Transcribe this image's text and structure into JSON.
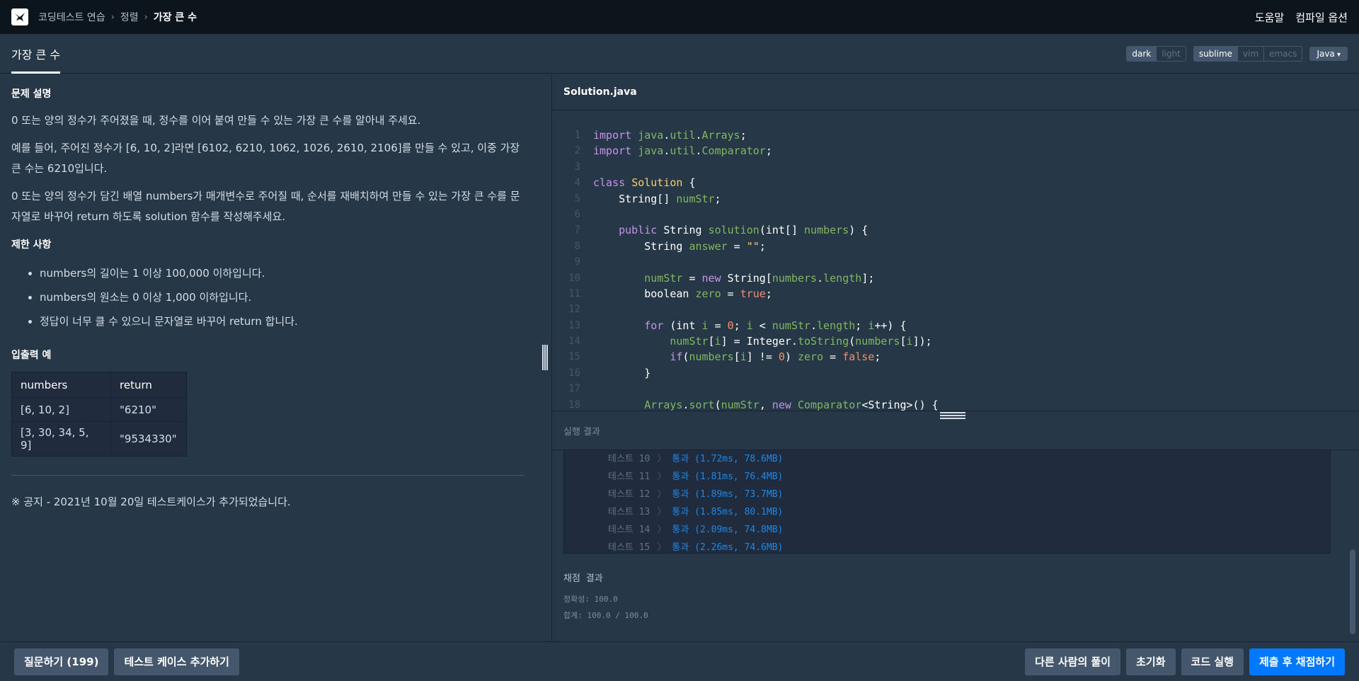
{
  "breadcrumb": {
    "items": [
      "코딩테스트 연습",
      "정렬"
    ],
    "current": "가장 큰 수"
  },
  "topbar": {
    "help": "도움말",
    "compile_options": "컴파일 옵션"
  },
  "title_tab": "가장 큰 수",
  "theme_toggle": {
    "dark": "dark",
    "light": "light"
  },
  "keymap_toggle": {
    "sublime": "sublime",
    "vim": "vim",
    "emacs": "emacs"
  },
  "language": "Java",
  "problem": {
    "desc_title": "문제 설명",
    "para1": "0 또는 양의 정수가 주어졌을 때, 정수를 이어 붙여 만들 수 있는 가장 큰 수를 알아내 주세요.",
    "para2": "예를 들어, 주어진 정수가 [6, 10, 2]라면 [6102, 6210, 1062, 1026, 2610, 2106]를 만들 수 있고, 이중 가장 큰 수는 6210입니다.",
    "para3": "0 또는 양의 정수가 담긴 배열 numbers가 매개변수로 주어질 때, 순서를 재배치하여 만들 수 있는 가장 큰 수를 문자열로 바꾸어 return 하도록 solution 함수를 작성해주세요.",
    "limits_title": "제한 사항",
    "limits": [
      "numbers의 길이는 1 이상 100,000 이하입니다.",
      "numbers의 원소는 0 이상 1,000 이하입니다.",
      "정답이 너무 클 수 있으니 문자열로 바꾸어 return 합니다."
    ],
    "io_title": "입출력 예",
    "io_headers": [
      "numbers",
      "return"
    ],
    "io_rows": [
      [
        "[6, 10, 2]",
        "\"6210\""
      ],
      [
        "[3, 30, 34, 5, 9]",
        "\"9534330\""
      ]
    ],
    "notice": "※ 공지 - 2021년 10월 20일 테스트케이스가 추가되었습니다."
  },
  "editor": {
    "filename": "Solution.java",
    "line_numbers": [
      "1",
      "2",
      "3",
      "4",
      "5",
      "6",
      "7",
      "8",
      "9",
      "10",
      "11",
      "12",
      "13",
      "14",
      "15",
      "16",
      "17",
      "18"
    ]
  },
  "result": {
    "header": "실행 결과",
    "tests": [
      {
        "name": "테스트 10",
        "result": "통과 (1.72ms, 78.6MB)"
      },
      {
        "name": "테스트 11",
        "result": "통과 (1.81ms, 76.4MB)"
      },
      {
        "name": "테스트 12",
        "result": "통과 (1.89ms, 73.7MB)"
      },
      {
        "name": "테스트 13",
        "result": "통과 (1.85ms, 80.1MB)"
      },
      {
        "name": "테스트 14",
        "result": "통과 (2.09ms, 74.8MB)"
      },
      {
        "name": "테스트 15",
        "result": "통과 (2.26ms, 74.6MB)"
      }
    ],
    "score_title": "채점 결과",
    "accuracy": "정확성: 100.0",
    "total": "합계: 100.0 / 100.0"
  },
  "bottom": {
    "ask": "질문하기 (199)",
    "add_test": "테스트 케이스 추가하기",
    "others": "다른 사람의 풀이",
    "reset": "초기화",
    "run": "코드 실행",
    "submit": "제출 후 채점하기"
  }
}
